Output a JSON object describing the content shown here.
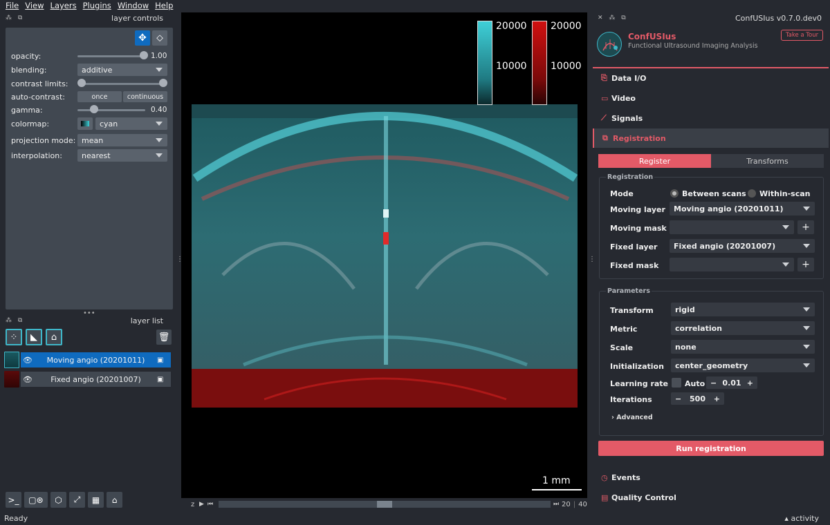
{
  "menu": [
    "File",
    "View",
    "Layers",
    "Plugins",
    "Window",
    "Help"
  ],
  "layer_controls": {
    "title": "layer controls",
    "opacity_label": "opacity:",
    "opacity_value": "1.00",
    "opacity_level": 1.0,
    "blending_label": "blending:",
    "blending_value": "additive",
    "contrast_label": "contrast limits:",
    "autocontrast_label": "auto-contrast:",
    "once": "once",
    "continuous": "continuous",
    "gamma_label": "gamma:",
    "gamma_value": "0.40",
    "gamma_level": 0.2,
    "colormap_label": "colormap:",
    "colormap_value": "cyan",
    "projection_label": "projection mode:",
    "projection_value": "mean",
    "interp_label": "interpolation:",
    "interp_value": "nearest"
  },
  "layer_list": {
    "title": "layer list",
    "layers": [
      {
        "name": "Moving angio (20201011)"
      },
      {
        "name": "Fixed angio (20201007)"
      }
    ]
  },
  "status": {
    "ready": "Ready",
    "activity": "activity"
  },
  "canvas": {
    "colorbars": [
      {
        "top": "20000",
        "mid": "10000",
        "color": "#3fd0d8"
      },
      {
        "top": "20000",
        "mid": "10000",
        "color": "#d01010"
      }
    ],
    "scalebar": "1 mm",
    "dims": {
      "axis": "z",
      "value": "20",
      "max": "40",
      "position": 0.5
    }
  },
  "plugin": {
    "dock_title": "ConfUSIus v0.7.0.dev0",
    "brand": "ConfUSIus",
    "subtitle": "Functional Ultrasound Imaging Analysis",
    "tour": "Take a Tour",
    "nav": [
      "Data I/O",
      "Video",
      "Signals",
      "Registration"
    ],
    "tabs": [
      "Register",
      "Transforms"
    ],
    "registration_group": "Registration",
    "mode_label": "Mode",
    "mode_opt1": "Between scans",
    "mode_opt2": "Within-scan",
    "moving_layer_label": "Moving layer",
    "moving_layer_value": "Moving angio (20201011)",
    "moving_mask_label": "Moving mask",
    "fixed_layer_label": "Fixed layer",
    "fixed_layer_value": "Fixed angio (20201007)",
    "fixed_mask_label": "Fixed mask",
    "parameters_group": "Parameters",
    "transform_label": "Transform",
    "transform_value": "rigid",
    "metric_label": "Metric",
    "metric_value": "correlation",
    "scale_label": "Scale",
    "scale_value": "none",
    "init_label": "Initialization",
    "init_value": "center_geometry",
    "lr_label": "Learning rate",
    "auto_label": "Auto",
    "lr_value": "0.01",
    "iter_label": "Iterations",
    "iter_value": "500",
    "advanced": "Advanced",
    "run": "Run registration",
    "bottom_nav": [
      "Events",
      "Quality Control"
    ]
  },
  "colors": {
    "accent": "#e35a67",
    "cyan": "#3fb7c9",
    "selected_layer": "#0f6bbf"
  }
}
